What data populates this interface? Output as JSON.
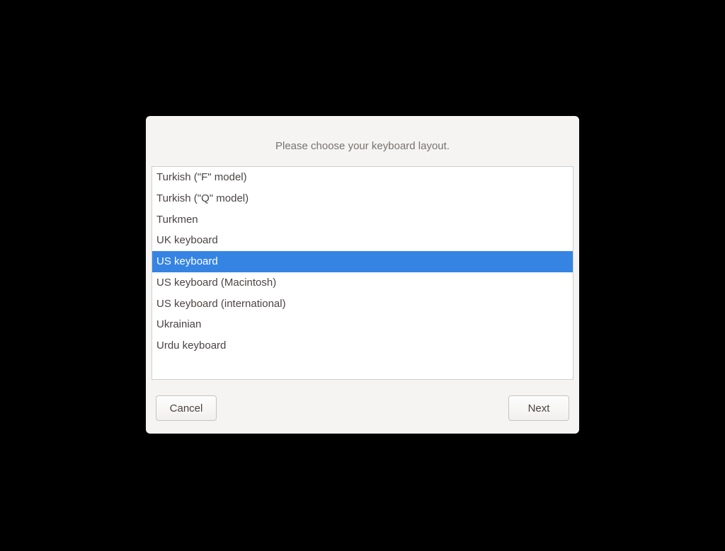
{
  "dialog": {
    "title": "Please choose your keyboard layout.",
    "items": [
      {
        "label": "Turkish (\"F\" model)",
        "selected": false
      },
      {
        "label": "Turkish (\"Q\" model)",
        "selected": false
      },
      {
        "label": "Turkmen",
        "selected": false
      },
      {
        "label": "UK keyboard",
        "selected": false
      },
      {
        "label": "US keyboard",
        "selected": true
      },
      {
        "label": "US keyboard (Macintosh)",
        "selected": false
      },
      {
        "label": "US keyboard (international)",
        "selected": false
      },
      {
        "label": "Ukrainian",
        "selected": false
      },
      {
        "label": "Urdu keyboard",
        "selected": false
      }
    ],
    "cancel_label": "Cancel",
    "next_label": "Next"
  }
}
